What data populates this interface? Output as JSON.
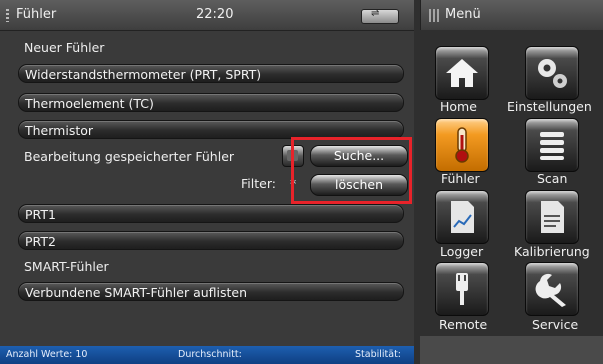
{
  "header": {
    "title": "Fühler",
    "time": "22:20",
    "usb_label": "USB"
  },
  "menu": {
    "title": "Menü"
  },
  "sections": {
    "new_sensor": "Neuer Fühler",
    "edit_saved": "Bearbeitung gespeicherter Fühler",
    "filter_label": "Filter:",
    "filter_value": "*",
    "smart": "SMART-Fühler"
  },
  "bars": {
    "prt": "Widerstandsthermometer (PRT, SPRT)",
    "tc": "Thermoelement (TC)",
    "thermistor": "Thermistor",
    "prt1": "PRT1",
    "prt2": "PRT2",
    "smart_list": "Verbundene SMART-Fühler auflisten"
  },
  "buttons": {
    "search": "Suche...",
    "delete": "löschen"
  },
  "status": {
    "count": "Anzahl Werte: 10",
    "average": "Durchschnitt:",
    "stability": "Stabilität:"
  },
  "tiles": {
    "home": "Home",
    "settings": "Einstellungen",
    "sensor": "Fühler",
    "scan": "Scan",
    "logger": "Logger",
    "calibration": "Kalibrierung",
    "remote": "Remote",
    "service": "Service"
  },
  "colors": {
    "active_tile": "#f39a21",
    "highlight": "#e8232a",
    "status_bar": "#1d5fb0"
  }
}
